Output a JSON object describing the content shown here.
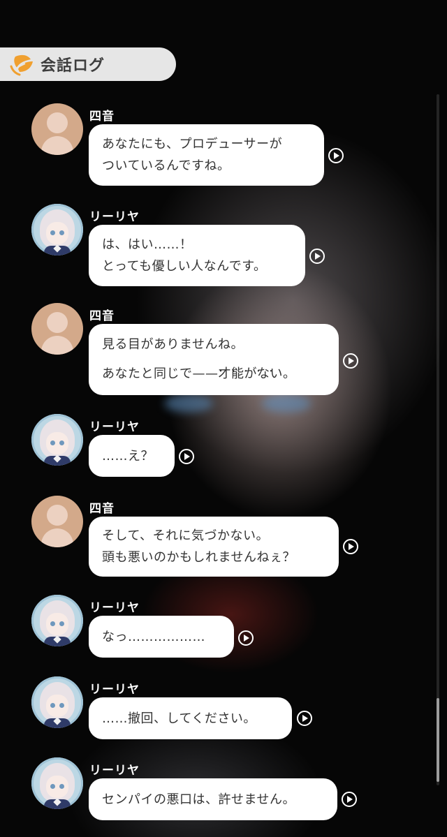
{
  "header": {
    "title": "会話ログ",
    "logo": "leaf-logo-icon"
  },
  "messages": [
    {
      "speaker": "四音",
      "avatar": "placeholder-avatar",
      "lines": [
        "あなたにも、プロデューサーが",
        "ついているんですね。"
      ]
    },
    {
      "speaker": "リーリヤ",
      "avatar": "character-avatar",
      "lines": [
        "は、はい……！",
        "とっても優しい人なんです。"
      ]
    },
    {
      "speaker": "四音",
      "avatar": "placeholder-avatar",
      "lines": [
        "見る目がありませんね。",
        "あなたと同じで——",
        "才能",
        "がない。"
      ]
    },
    {
      "speaker": "リーリヤ",
      "avatar": "character-avatar",
      "lines": [
        "……え？"
      ]
    },
    {
      "speaker": "四音",
      "avatar": "placeholder-avatar",
      "lines": [
        "そして、それに気づかない。",
        "頭も悪いのかもしれませんねぇ？"
      ]
    },
    {
      "speaker": "リーリヤ",
      "avatar": "character-avatar",
      "lines": [
        "なっ………………"
      ]
    },
    {
      "speaker": "リーリヤ",
      "avatar": "character-avatar",
      "lines": [
        "……撤回、してください。"
      ]
    },
    {
      "speaker": "リーリヤ",
      "avatar": "character-avatar",
      "lines": [
        "センパイの悪口は、許せません。"
      ]
    }
  ],
  "colors": {
    "header_bg": "#e6e6e6",
    "bubble_bg": "#ffffff",
    "logo_orange": "#f0a030",
    "avatar_placeholder": "#d3a98a"
  },
  "icons": {
    "voice_play": "play-circle-icon"
  }
}
